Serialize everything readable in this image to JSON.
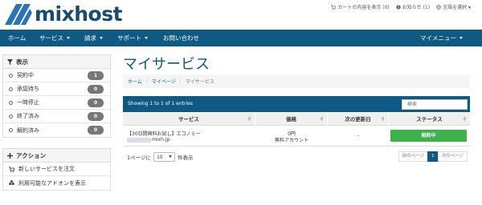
{
  "brand": {
    "name": "mixhost",
    "color": "#1a4a6e"
  },
  "utility_links": [
    {
      "icon": "cart-icon",
      "label": "カートの内容を表示 (0)"
    },
    {
      "icon": "info-icon",
      "label": "お知らせ (1)"
    },
    {
      "icon": "globe-icon",
      "label": "言語を選択 ▾"
    }
  ],
  "nav": {
    "items": [
      {
        "label": "ホーム",
        "dropdown": false
      },
      {
        "label": "サービス",
        "dropdown": true
      },
      {
        "label": "請求",
        "dropdown": true
      },
      {
        "label": "サポート",
        "dropdown": true
      },
      {
        "label": "お問い合わせ",
        "dropdown": false
      }
    ],
    "account": {
      "label": "マイメニュー",
      "dropdown": true
    },
    "color": "#0e5a82"
  },
  "sidebar": {
    "filter": {
      "title": "表示",
      "icon": "filter-icon",
      "items": [
        {
          "label": "契約中",
          "count": "1"
        },
        {
          "label": "承認待ち",
          "count": "0"
        },
        {
          "label": "一時停止",
          "count": "0"
        },
        {
          "label": "終了済み",
          "count": "0"
        },
        {
          "label": "解約済み",
          "count": "0"
        }
      ]
    },
    "actions": {
      "title": "アクション",
      "icon": "plus-icon",
      "items": [
        {
          "label": "新しいサービスを注文",
          "icon": "cart-icon"
        },
        {
          "label": "利用可能なアドオンを表示",
          "icon": "cubes-icon"
        }
      ]
    }
  },
  "main": {
    "title": "マイサービス",
    "breadcrumb": [
      "ホーム",
      "マイページ",
      "マイサービス"
    ],
    "table": {
      "info": "Showing 1 to 1 of 1 entries",
      "search_placeholder": "検索",
      "columns": [
        "サービス",
        "価格",
        "次の更新日",
        "ステータス"
      ],
      "rows": [
        {
          "service": "【30日間無料お試し】エコノミー",
          "domain": "mixh.jp",
          "price": "0円",
          "billing": "無料アカウント",
          "next_due": "-",
          "status": "契約中"
        }
      ],
      "status_color": "#3db24b"
    },
    "length_menu": {
      "prefix": "1ページに",
      "value": "10",
      "suffix": "件表示"
    },
    "pagination": {
      "prev": "前のページ",
      "current": "1",
      "next": "次のページ"
    }
  }
}
